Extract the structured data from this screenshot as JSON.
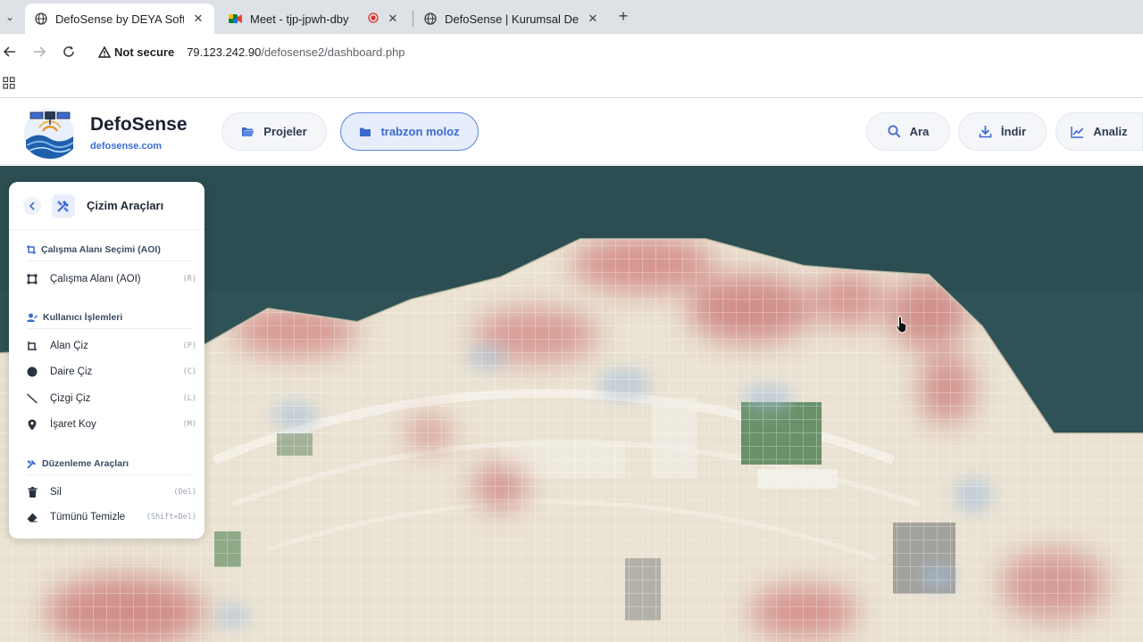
{
  "browser": {
    "tabs": [
      {
        "title": "DefoSense by DEYA Soft",
        "favicon": "globe-icon",
        "active": true
      },
      {
        "title": "Meet - tjp-jpwh-dby",
        "favicon": "meet-icon",
        "recording": true
      },
      {
        "title": "DefoSense | Kurumsal De",
        "favicon": "globe-icon"
      }
    ],
    "security_label": "Not secure",
    "url_host": "79.123.242.90",
    "url_path": "/defosense2/dashboard.php"
  },
  "header": {
    "brand_name": "DefoSense",
    "brand_url": "defosense.com",
    "nav": {
      "projects_label": "Projeler",
      "project_label": "trabzon moloz",
      "search_label": "Ara",
      "download_label": "İndir",
      "analysis_label": "Analiz"
    }
  },
  "panel": {
    "title": "Çizim Araçları",
    "sections": {
      "aoi": {
        "title": "Çalışma Alanı Seçimi (AOI)",
        "tools": [
          {
            "label": "Çalışma Alanı (AOI)",
            "key": "(R)",
            "icon": "square-select-icon"
          }
        ]
      },
      "user": {
        "title": "Kullanıcı İşlemleri",
        "tools": [
          {
            "label": "Alan Çiz",
            "key": "(P)",
            "icon": "polygon-icon"
          },
          {
            "label": "Daire Çiz",
            "key": "(C)",
            "icon": "circle-icon"
          },
          {
            "label": "Çizgi Çiz",
            "key": "(L)",
            "icon": "line-icon"
          },
          {
            "label": "İşaret Koy",
            "key": "(M)",
            "icon": "map-pin-icon"
          }
        ]
      },
      "edit": {
        "title": "Düzenleme Araçları",
        "tools": [
          {
            "label": "Sil",
            "key": "(Del)",
            "icon": "trash-icon"
          },
          {
            "label": "Tümünü Temizle",
            "key": "(Shift+Del)",
            "icon": "eraser-icon"
          }
        ]
      }
    }
  },
  "colors": {
    "accent": "#3d6ad0",
    "sea": "#2f5357",
    "deformation_high": "#c0474a",
    "deformation_low": "#8fb2d8"
  }
}
